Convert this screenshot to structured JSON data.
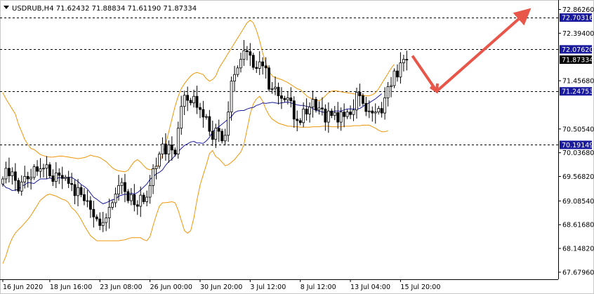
{
  "chart_data": {
    "type": "candlestick",
    "symbol": "USDRUB,H4",
    "ohlc_text": "71.62432 71.88834 71.61190 71.87334",
    "title": "USDRUB,H4  71.62432 71.88834 71.61190 71.87334",
    "ylim": [
      67.54,
      73.05
    ],
    "y_ticks": [
      "72.86260",
      "72.39400",
      "71.45680",
      "70.50540",
      "70.03680",
      "69.56820",
      "69.08540",
      "68.61680",
      "68.14820",
      "67.67960"
    ],
    "y_tick_values": [
      72.8626,
      72.394,
      71.4568,
      70.5054,
      70.0368,
      69.5682,
      69.0854,
      68.6168,
      68.1482,
      67.6796
    ],
    "x_ticks": [
      "16 Jun 2020",
      "18 Jun 16:00",
      "23 Jun 08:00",
      "26 Jun 00:00",
      "30 Jun 20:00",
      "3 Jul 12:00",
      "8 Jul 12:00",
      "13 Jul 04:00",
      "15 Jul 20:00"
    ],
    "x_tick_index": [
      0,
      15,
      31,
      47,
      63,
      79,
      95,
      111,
      127
    ],
    "levels": [
      {
        "label": "72.70316",
        "value": 72.70316
      },
      {
        "label": "72.07620",
        "value": 72.0762
      },
      {
        "label": "71.24753",
        "value": 71.24753
      },
      {
        "label": "70.19149",
        "value": 70.19149
      }
    ],
    "current": {
      "label": "71.87334",
      "value": 71.87334
    },
    "series": [
      {
        "name": "Close",
        "values": [
          69.52,
          69.73,
          69.58,
          69.66,
          69.49,
          69.28,
          69.46,
          69.57,
          69.52,
          69.55,
          69.76,
          69.67,
          69.72,
          69.73,
          69.8,
          69.58,
          69.47,
          69.64,
          69.59,
          69.53,
          69.55,
          69.43,
          69.41,
          69.19,
          69.35,
          69.21,
          69.09,
          69.09,
          68.92,
          68.77,
          68.73,
          68.6,
          68.66,
          68.75,
          68.96,
          69.05,
          69.22,
          69.39,
          69.45,
          69.27,
          69.09,
          69.21,
          69.01,
          68.98,
          69.2,
          69.07,
          69.16,
          69.39,
          69.72,
          69.77,
          70.01,
          70.21,
          70.01,
          70.19,
          70.09,
          70.01,
          70.52,
          70.95,
          71.17,
          71.07,
          71.02,
          71.15,
          70.93,
          70.89,
          70.74,
          70.75,
          70.46,
          70.3,
          70.52,
          70.46,
          70.27,
          70.38,
          70.84,
          71.45,
          71.58,
          71.71,
          71.88,
          72.05,
          72.03,
          71.96,
          71.72,
          71.7,
          71.83,
          71.75,
          71.71,
          71.29,
          71.3,
          71.33,
          71.16,
          71.11,
          71.08,
          71.12,
          71.06,
          70.7,
          70.67,
          70.63,
          70.9,
          70.8,
          70.94,
          71.09,
          70.88,
          70.92,
          70.9,
          70.64,
          70.86,
          70.77,
          70.83,
          70.64,
          70.84,
          70.75,
          70.84,
          70.79,
          70.88,
          71.23,
          71.16,
          71.01,
          70.85,
          70.86,
          70.82,
          70.84,
          70.91,
          70.82,
          71.12,
          71.34,
          71.36,
          71.65,
          71.53,
          71.81,
          71.88,
          71.87
        ]
      },
      {
        "name": "MA",
        "values": [
          69.42,
          69.35,
          69.33,
          69.29,
          69.3,
          69.31,
          69.38,
          69.4,
          69.45,
          69.44,
          69.43,
          69.48,
          69.52,
          69.52,
          69.52,
          69.54,
          69.51,
          69.52,
          69.55,
          69.53,
          69.55,
          69.55,
          69.55,
          69.51,
          69.47,
          69.41,
          69.37,
          69.32,
          69.24,
          69.16,
          69.12,
          69.07,
          69.03,
          69.05,
          69.08,
          69.11,
          69.12,
          69.18,
          69.2,
          69.22,
          69.21,
          69.24,
          69.22,
          69.25,
          69.3,
          69.36,
          69.42,
          69.51,
          69.56,
          69.62,
          69.65,
          69.7,
          69.79,
          69.86,
          69.91,
          69.98,
          70.06,
          70.12,
          70.18,
          70.21,
          70.25,
          70.26,
          70.23,
          70.23,
          70.22,
          70.27,
          70.34,
          70.45,
          70.51,
          70.55,
          70.6,
          70.65,
          70.7,
          70.75,
          70.83,
          70.86,
          70.87,
          70.87,
          70.9,
          70.92,
          70.93,
          70.97,
          70.99,
          71.02,
          71.01,
          71.02,
          71.03,
          71.02,
          71.01,
          71.02,
          71.03,
          71.04,
          71.02,
          71,
          70.98,
          70.97,
          70.97,
          70.95,
          70.94,
          70.91,
          70.87,
          70.86,
          70.84,
          70.83,
          70.84,
          70.84,
          70.86,
          70.86,
          70.86,
          70.88,
          70.9,
          70.9,
          70.9,
          70.9,
          70.91,
          70.95,
          70.99,
          71.02,
          71.06,
          71.1,
          71.15,
          71.2
        ]
      },
      {
        "name": "BB Upper",
        "values": [
          71.22,
          71.1,
          71.0,
          70.9,
          70.8,
          70.6,
          70.45,
          70.3,
          70.2,
          70.12,
          70.1,
          70.05,
          70.0,
          69.98,
          69.96,
          69.95,
          69.95,
          69.96,
          69.97,
          69.97,
          69.96,
          69.95,
          69.94,
          69.93,
          69.92,
          69.93,
          69.94,
          69.96,
          69.99,
          69.97,
          69.96,
          69.94,
          69.9,
          69.86,
          69.8,
          69.74,
          69.7,
          69.68,
          69.67,
          69.66,
          69.69,
          69.78,
          69.86,
          69.9,
          69.85,
          69.78,
          69.72,
          69.7,
          69.71,
          69.74,
          69.82,
          70.0,
          70.2,
          70.45,
          70.7,
          70.95,
          71.15,
          71.3,
          71.4,
          71.48,
          71.55,
          71.6,
          71.62,
          71.6,
          71.58,
          71.5,
          71.45,
          71.48,
          71.55,
          71.7,
          71.8,
          71.9,
          72.0,
          72.1,
          72.2,
          72.3,
          72.4,
          72.5,
          72.6,
          72.65,
          72.6,
          72.45,
          72.25,
          72.0,
          71.8,
          71.65,
          71.55,
          71.52,
          71.5,
          71.48,
          71.45,
          71.42,
          71.38,
          71.34,
          71.3,
          71.28,
          71.22,
          71.16,
          71.12,
          71.1,
          71.08,
          71.06,
          71.1,
          71.16,
          71.22,
          71.25,
          71.26,
          71.25,
          71.24,
          71.23,
          71.22,
          71.21,
          71.2,
          71.19,
          71.18,
          71.17,
          71.16,
          71.16,
          71.18,
          71.22,
          71.3,
          71.4,
          71.5,
          71.6,
          71.7,
          71.78
        ]
      },
      {
        "name": "BB Lower",
        "values": [
          67.85,
          68.0,
          68.2,
          68.35,
          68.45,
          68.52,
          68.58,
          68.65,
          68.72,
          68.8,
          68.9,
          69.0,
          69.1,
          69.15,
          69.2,
          69.22,
          69.2,
          69.18,
          69.15,
          69.12,
          69.1,
          69.05,
          68.95,
          68.9,
          68.82,
          68.72,
          68.6,
          68.5,
          68.4,
          68.35,
          68.3,
          68.3,
          68.3,
          68.3,
          68.3,
          68.3,
          68.3,
          68.3,
          68.31,
          68.32,
          68.34,
          68.36,
          68.36,
          68.36,
          68.36,
          68.32,
          68.3,
          68.38,
          68.6,
          68.8,
          68.98,
          69.05,
          69.05,
          69.06,
          69.07,
          69.05,
          68.9,
          68.7,
          68.5,
          68.45,
          68.5,
          68.75,
          69.1,
          69.4,
          69.6,
          69.8,
          70.02,
          70.08,
          69.96,
          69.92,
          69.85,
          69.78,
          69.8,
          69.85,
          69.9,
          69.98,
          70.05,
          70.2,
          70.5,
          70.8,
          71.0,
          71.1,
          71.15,
          71.05,
          70.9,
          70.78,
          70.7,
          70.66,
          70.62,
          70.6,
          70.58,
          70.56,
          70.56,
          70.55,
          70.55,
          70.54,
          70.54,
          70.54,
          70.54,
          70.55,
          70.55,
          70.55,
          70.56,
          70.56,
          70.56,
          70.55,
          70.55,
          70.55,
          70.55,
          70.56,
          70.56,
          70.56,
          70.57,
          70.57,
          70.57,
          70.58,
          70.58,
          70.58,
          70.55,
          70.52,
          70.48,
          70.45,
          70.45,
          70.47
        ]
      }
    ],
    "colors": {
      "bull_body": "#ffffff",
      "bull_outline": "#000000",
      "bear_body": "#000000",
      "candle_wick": "#000000",
      "ma": "#1a1a9e",
      "bollinger": "#f0960a",
      "level_line": "#000000",
      "price_label_bg": "#1a1a9e",
      "price_label_text": "#ffffff",
      "arrow": "#e8564a"
    },
    "legend": "none",
    "grid": false
  }
}
